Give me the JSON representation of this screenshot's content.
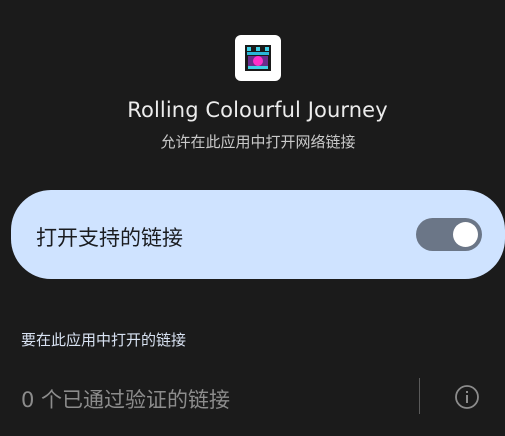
{
  "app": {
    "name": "Rolling Colourful Journey",
    "subtitle": "允许在此应用中打开网络链接",
    "icon": "rolling-colourful-journey-app-icon"
  },
  "toggle": {
    "label": "打开支持的链接",
    "enabled": true,
    "card_color": "#cfe3ff",
    "track_color": "#6b7687"
  },
  "links_section": {
    "header": "要在此应用中打开的链接",
    "verified_links_text": "0 个已通过验证的链接",
    "info_icon": "info-icon"
  },
  "colors": {
    "background": "#1b1b1b"
  }
}
